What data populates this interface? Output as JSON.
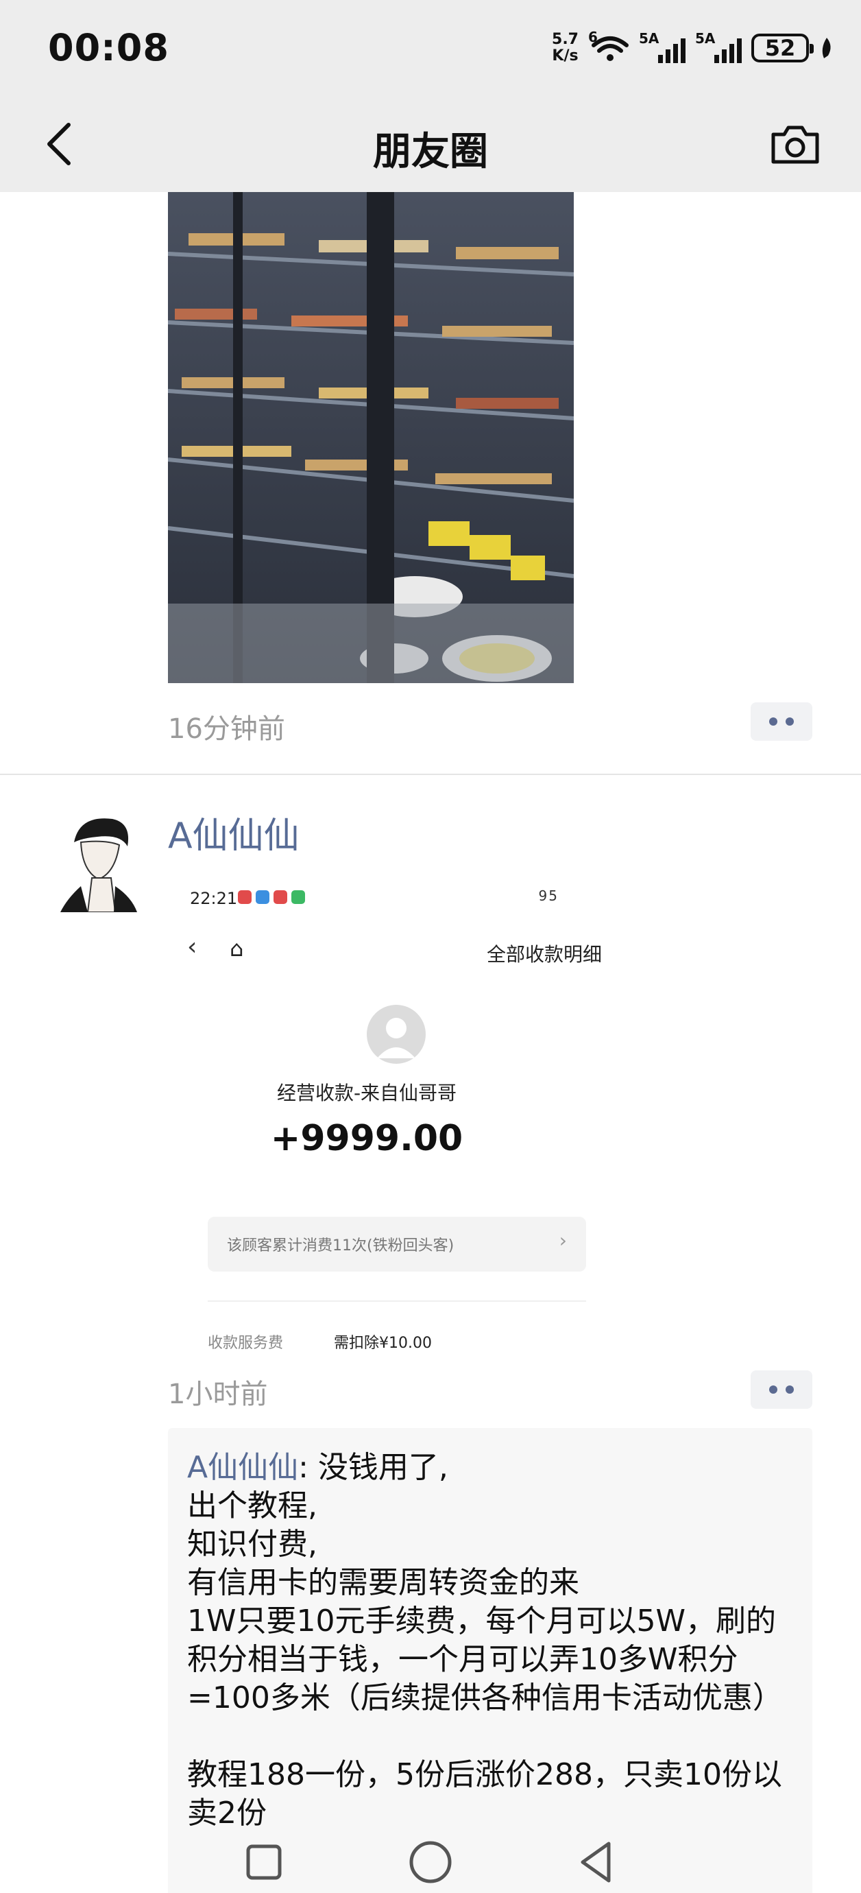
{
  "status_bar": {
    "time": "00:08",
    "net_speed_value": "5.7",
    "net_speed_unit": "K/s",
    "wifi_label": "6",
    "sim1_label": "5A",
    "sim2_label": "5A",
    "battery": "52"
  },
  "nav": {
    "title": "朋友圈",
    "back_icon": "chevron-left-icon",
    "camera_icon": "camera-icon"
  },
  "posts": [
    {
      "time_ago": "16分钟前"
    },
    {
      "author": "A仙仙仙",
      "time_ago": "1小时前",
      "screenshot": {
        "time": "22:21",
        "status_right": "95",
        "header_title": "全部收款明细",
        "payer_text": "经营收款-来自仙哥哥",
        "amount": "+9999.00",
        "card_text": "该顾客累计消费11次(铁粉回头客)",
        "fee_label": "收款服务费",
        "fee_value": "需扣除¥10.00"
      },
      "comment": {
        "author": "A仙仙仙",
        "separator": ": ",
        "body": "没钱用了,\n出个教程,\n知识付费,\n有信用卡的需要周转资金的来\n1W只要10元手续费，每个月可以5W，刷的积分相当于钱，一个月可以弄10多W积分=100多米（后续提供各种信用卡活动优惠）\n\n教程188一份，5份后涨价288，只卖10份以卖2份"
      }
    }
  ],
  "colors": {
    "link": "#576b95",
    "header_bg": "#ededed",
    "timestamp": "#9a9a9a"
  }
}
